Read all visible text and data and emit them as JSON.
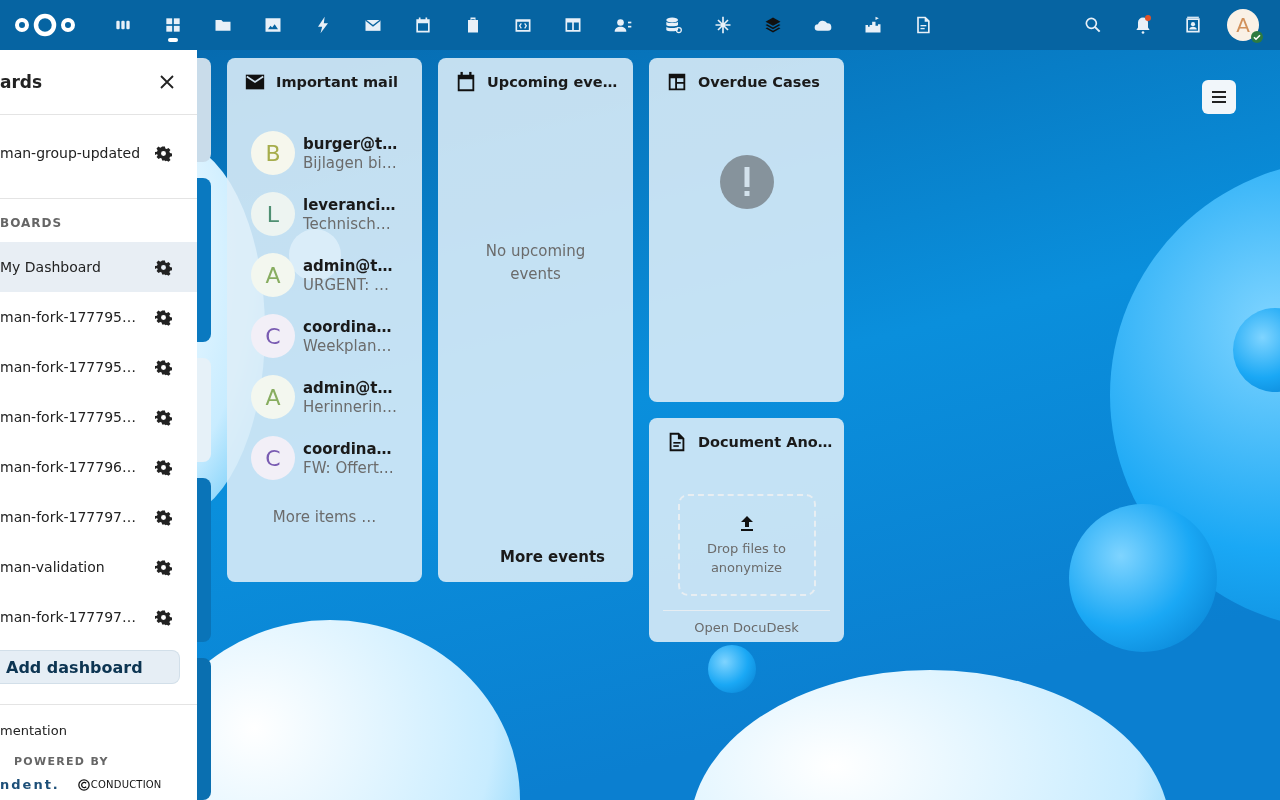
{
  "top_bar": {
    "apps": [
      {
        "selected": false
      },
      {
        "selected": true
      },
      {
        "selected": false
      },
      {
        "selected": false
      },
      {
        "selected": false
      },
      {
        "selected": false
      },
      {
        "selected": false
      },
      {
        "selected": false
      },
      {
        "selected": false
      },
      {
        "selected": false
      },
      {
        "selected": false
      },
      {
        "selected": false
      },
      {
        "selected": false
      },
      {
        "selected": false
      },
      {
        "selected": false
      },
      {
        "selected": false
      },
      {
        "selected": false
      }
    ],
    "notifications": {
      "unread": true
    },
    "avatar": {
      "initial": "A",
      "online": true
    }
  },
  "sidebar": {
    "title": "ards",
    "top_items": [
      {
        "label": "man-group-updated",
        "selected": false
      }
    ],
    "section_heading": "BOARDS",
    "items": [
      {
        "label": "My Dashboard",
        "selected": true
      },
      {
        "label": "man-fork-177795…",
        "selected": false
      },
      {
        "label": "man-fork-177795…",
        "selected": false
      },
      {
        "label": "man-fork-177795…",
        "selected": false
      },
      {
        "label": "man-fork-177796…",
        "selected": false
      },
      {
        "label": "man-fork-177797…",
        "selected": false
      },
      {
        "label": "man-validation",
        "selected": false
      },
      {
        "label": "man-fork-177797…",
        "selected": false
      }
    ],
    "add_button": "Add dashboard",
    "footer_link": "mentation",
    "powered_by": "POWERED BY",
    "logos": [
      "ndent.",
      "CONDUCTION"
    ]
  },
  "widgets": [
    {
      "kind": "mail",
      "title": "Important mail",
      "items": [
        {
          "initial": "B",
          "color": "#a6ad4c",
          "sender": "burger@t…",
          "subject": "Bijlagen bi…"
        },
        {
          "initial": "L",
          "color": "#4f8f72",
          "sender": "leveranci…",
          "subject": "Technisch…"
        },
        {
          "initial": "A",
          "color": "#88ad60",
          "sender": "admin@t…",
          "subject": "URGENT: …"
        },
        {
          "initial": "C",
          "color": "#7a5cb2",
          "sender": "coordina…",
          "subject": "Weekplan…"
        },
        {
          "initial": "A",
          "color": "#88ad60",
          "sender": "admin@t…",
          "subject": "Herinnerin…"
        },
        {
          "initial": "C",
          "color": "#7a5cb2",
          "sender": "coordina…",
          "subject": "FW: Offert…"
        }
      ],
      "footer": "More items …"
    },
    {
      "kind": "events",
      "title": "Upcoming eve…",
      "empty_text": "No upcoming events",
      "footer": "More events"
    },
    {
      "kind": "error",
      "title": "Overdue Cases"
    },
    {
      "kind": "upload",
      "title": "Document Ano…",
      "drop_text": "Drop files to anonymize",
      "footer": "Open DocuDesk"
    }
  ]
}
